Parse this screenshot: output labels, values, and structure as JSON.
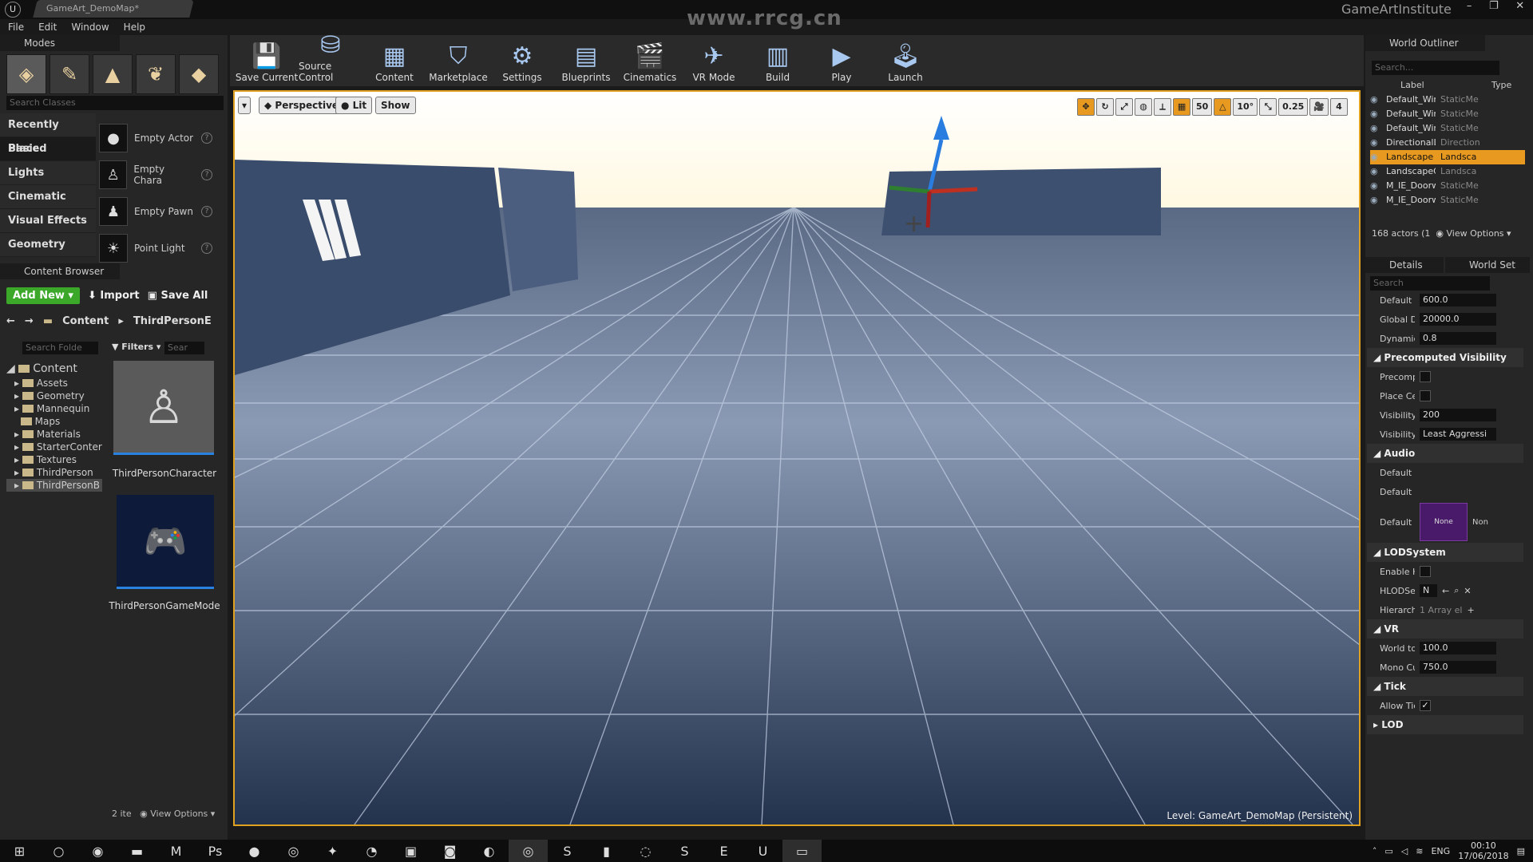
{
  "window": {
    "doc_tab": "GameArt_DemoMap*",
    "watermark": "www.rrcg.cn",
    "project": "GameArtInstitute",
    "controls": [
      "–",
      "❐",
      "✕"
    ]
  },
  "menu": [
    "File",
    "Edit",
    "Window",
    "Help"
  ],
  "modes": {
    "tab_label": "Modes",
    "search_placeholder": "Search Classes",
    "categories": [
      "Recently Placed",
      "Basic",
      "Lights",
      "Cinematic",
      "Visual Effects",
      "Geometry"
    ],
    "active_category": "Basic",
    "items": [
      {
        "label": "Empty Actor",
        "icon": "sphere-icon"
      },
      {
        "label": "Empty Chara",
        "icon": "character-icon"
      },
      {
        "label": "Empty Pawn",
        "icon": "pawn-icon"
      },
      {
        "label": "Point Light",
        "icon": "bulb-icon"
      }
    ]
  },
  "content_browser": {
    "tab_label": "Content Browser",
    "add_new": "Add New",
    "import": "Import",
    "save_all": "Save All",
    "path": [
      "Content",
      "ThirdPersonE"
    ],
    "folder_search_placeholder": "Search Folde",
    "filters": "Filters",
    "asset_search_placeholder": "Sear",
    "tree": {
      "root": "Content",
      "folders": [
        "Assets",
        "Geometry",
        "Mannequin",
        "Maps",
        "Materials",
        "StarterConter",
        "Textures",
        "ThirdPerson",
        "ThirdPersonB"
      ],
      "selected": "ThirdPersonB"
    },
    "assets": [
      {
        "label": "ThirdPersonCharacter",
        "icon": "mannequin-icon"
      },
      {
        "label": "ThirdPersonGameMode",
        "icon": "gamepad-icon"
      }
    ],
    "count": "2 ite",
    "view_options": "View Options"
  },
  "toolbar": [
    {
      "label": "Save Current",
      "icon": "save-icon"
    },
    {
      "label": "Source Control",
      "icon": "source-control-icon"
    },
    {
      "label": "Content",
      "icon": "content-icon"
    },
    {
      "label": "Marketplace",
      "icon": "marketplace-icon"
    },
    {
      "label": "Settings",
      "icon": "settings-icon"
    },
    {
      "label": "Blueprints",
      "icon": "blueprints-icon"
    },
    {
      "label": "Cinematics",
      "icon": "cinematics-icon"
    },
    {
      "label": "VR Mode",
      "icon": "vr-icon"
    },
    {
      "label": "Build",
      "icon": "build-icon"
    },
    {
      "label": "Play",
      "icon": "play-icon"
    },
    {
      "label": "Launch",
      "icon": "launch-icon"
    }
  ],
  "viewport": {
    "perspective": "Perspective",
    "lit": "Lit",
    "show": "Show",
    "grid_snap": "50",
    "rotation_snap": "10°",
    "scale_snap": "0.25",
    "camera_speed": "4",
    "level": "Level:  GameArt_DemoMap (Persistent)"
  },
  "outliner": {
    "tab_label": "World Outliner",
    "search_placeholder": "Search...",
    "col_label": "Label",
    "col_type": "Type",
    "rows": [
      {
        "name": "Default_Win",
        "type": "StaticMe"
      },
      {
        "name": "Default_Win",
        "type": "StaticMe"
      },
      {
        "name": "Default_Win",
        "type": "StaticMe"
      },
      {
        "name": "DirectionalL",
        "type": "Direction"
      },
      {
        "name": "Landscape",
        "type": "Landsca"
      },
      {
        "name": "LandscapeG",
        "type": "Landsca"
      },
      {
        "name": "M_IE_Doorw",
        "type": "StaticMe"
      },
      {
        "name": "M_IE_Doorw",
        "type": "StaticMe"
      }
    ],
    "selected_index": 4,
    "actor_count": "168 actors (1",
    "view_options": "View Options"
  },
  "details": {
    "tab_label": "Details",
    "world_tab": "World Set",
    "search_placeholder": "Search",
    "rows_top": [
      {
        "label": "Default M",
        "value": "600.0"
      },
      {
        "label": "Global Dis",
        "value": "20000.0"
      },
      {
        "label": "Dynamic I",
        "value": "0.8"
      }
    ],
    "sections": {
      "precomputed": "Precomputed Visibility",
      "audio": "Audio",
      "lod": "LODSystem",
      "vr": "VR",
      "tick": "Tick",
      "lod2": "LOD"
    },
    "precomputed_rows": [
      {
        "label": "Precompu"
      },
      {
        "label": "Place Cell"
      },
      {
        "label": "Visibility C",
        "value": "200"
      },
      {
        "label": "Visibility A",
        "value": "Least Aggressi"
      }
    ],
    "audio_rows": [
      "Default Re",
      "Default Ar",
      "Default Ba"
    ],
    "audio_thumb": "None",
    "audio_dropdown": "Non",
    "lod_rows": [
      {
        "label": "Enable Hie"
      },
      {
        "label": "HLODSetu",
        "value": "N"
      },
      {
        "label": "Hierarchical",
        "value": "1 Array el"
      }
    ],
    "vr_rows": [
      {
        "label": "World to M",
        "value": "100.0"
      },
      {
        "label": "Mono Cull",
        "value": "750.0"
      }
    ],
    "tick_rows": [
      {
        "label": "Allow Tick"
      }
    ]
  },
  "taskbar": {
    "apps": [
      "windows-icon",
      "search-icon",
      "chrome-icon",
      "explorer-icon",
      "maya-icon",
      "photoshop-icon",
      "app-icon",
      "steam-icon",
      "app-icon",
      "blender-icon",
      "app-icon",
      "app-icon",
      "app-icon",
      "steam-icon",
      "app-icon",
      "app-icon",
      "app-icon",
      "skype-icon",
      "epic-icon",
      "unreal-icon",
      "app-icon"
    ],
    "lang": "ENG",
    "time": "00:10",
    "date": "17/06/2018"
  }
}
